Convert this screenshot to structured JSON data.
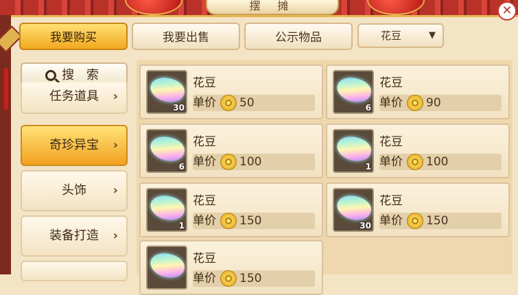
{
  "header": {
    "title": "摆 摊",
    "close_label": "✕"
  },
  "tabs": [
    {
      "label": "我要购买",
      "active": true
    },
    {
      "label": "我要出售",
      "active": false
    },
    {
      "label": "公示物品",
      "active": false
    }
  ],
  "filter": {
    "selected": "花豆",
    "arrow": "▼"
  },
  "sidebar": {
    "search_label": "搜 索",
    "categories": [
      {
        "label": "任务道具",
        "active": false
      },
      {
        "label": "奇珍异宝",
        "active": true
      },
      {
        "label": "头饰",
        "active": false
      },
      {
        "label": "装备打造",
        "active": false
      }
    ],
    "chevron": "›"
  },
  "items": [
    {
      "name": "花豆",
      "qty": "30",
      "price_label": "单价",
      "price": "50"
    },
    {
      "name": "花豆",
      "qty": "6",
      "price_label": "单价",
      "price": "90"
    },
    {
      "name": "花豆",
      "qty": "6",
      "price_label": "单价",
      "price": "100"
    },
    {
      "name": "花豆",
      "qty": "1",
      "price_label": "单价",
      "price": "100"
    },
    {
      "name": "花豆",
      "qty": "1",
      "price_label": "单价",
      "price": "150"
    },
    {
      "name": "花豆",
      "qty": "30",
      "price_label": "单价",
      "price": "150"
    },
    {
      "name": "花豆",
      "qty": "",
      "price_label": "单价",
      "price": "150"
    }
  ],
  "colors": {
    "accent": "#f2a820",
    "panel": "#f4e4c6",
    "roof": "#b8322a"
  }
}
